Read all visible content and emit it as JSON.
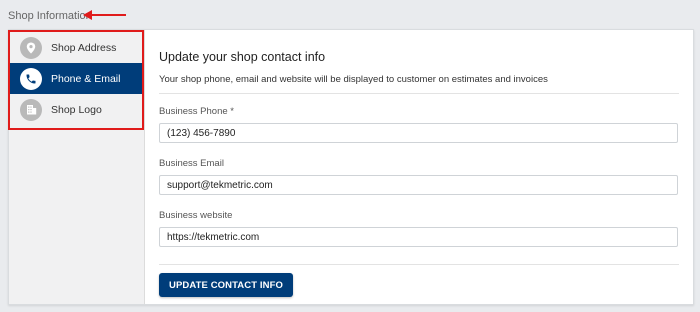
{
  "page": {
    "title": "Shop Information"
  },
  "colors": {
    "accent": "#003d7a",
    "annotation": "#e01b1b",
    "sidebar_bg": "#f1f1f2",
    "page_bg": "#e9ebee"
  },
  "sidebar": {
    "items": [
      {
        "label": "Shop Address",
        "icon": "map-pin-icon",
        "active": false
      },
      {
        "label": "Phone & Email",
        "icon": "phone-icon",
        "active": true
      },
      {
        "label": "Shop Logo",
        "icon": "building-icon",
        "active": false
      }
    ]
  },
  "section": {
    "title": "Update your shop contact info",
    "description": "Your shop phone, email and website will be displayed to customer on estimates and invoices"
  },
  "form": {
    "phone": {
      "label": "Business Phone *",
      "value": "(123) 456-7890"
    },
    "email": {
      "label": "Business Email",
      "value": "support@tekmetric.com"
    },
    "website": {
      "label": "Business website",
      "value": "https://tekmetric.com"
    },
    "submit_label": "UPDATE CONTACT INFO"
  }
}
